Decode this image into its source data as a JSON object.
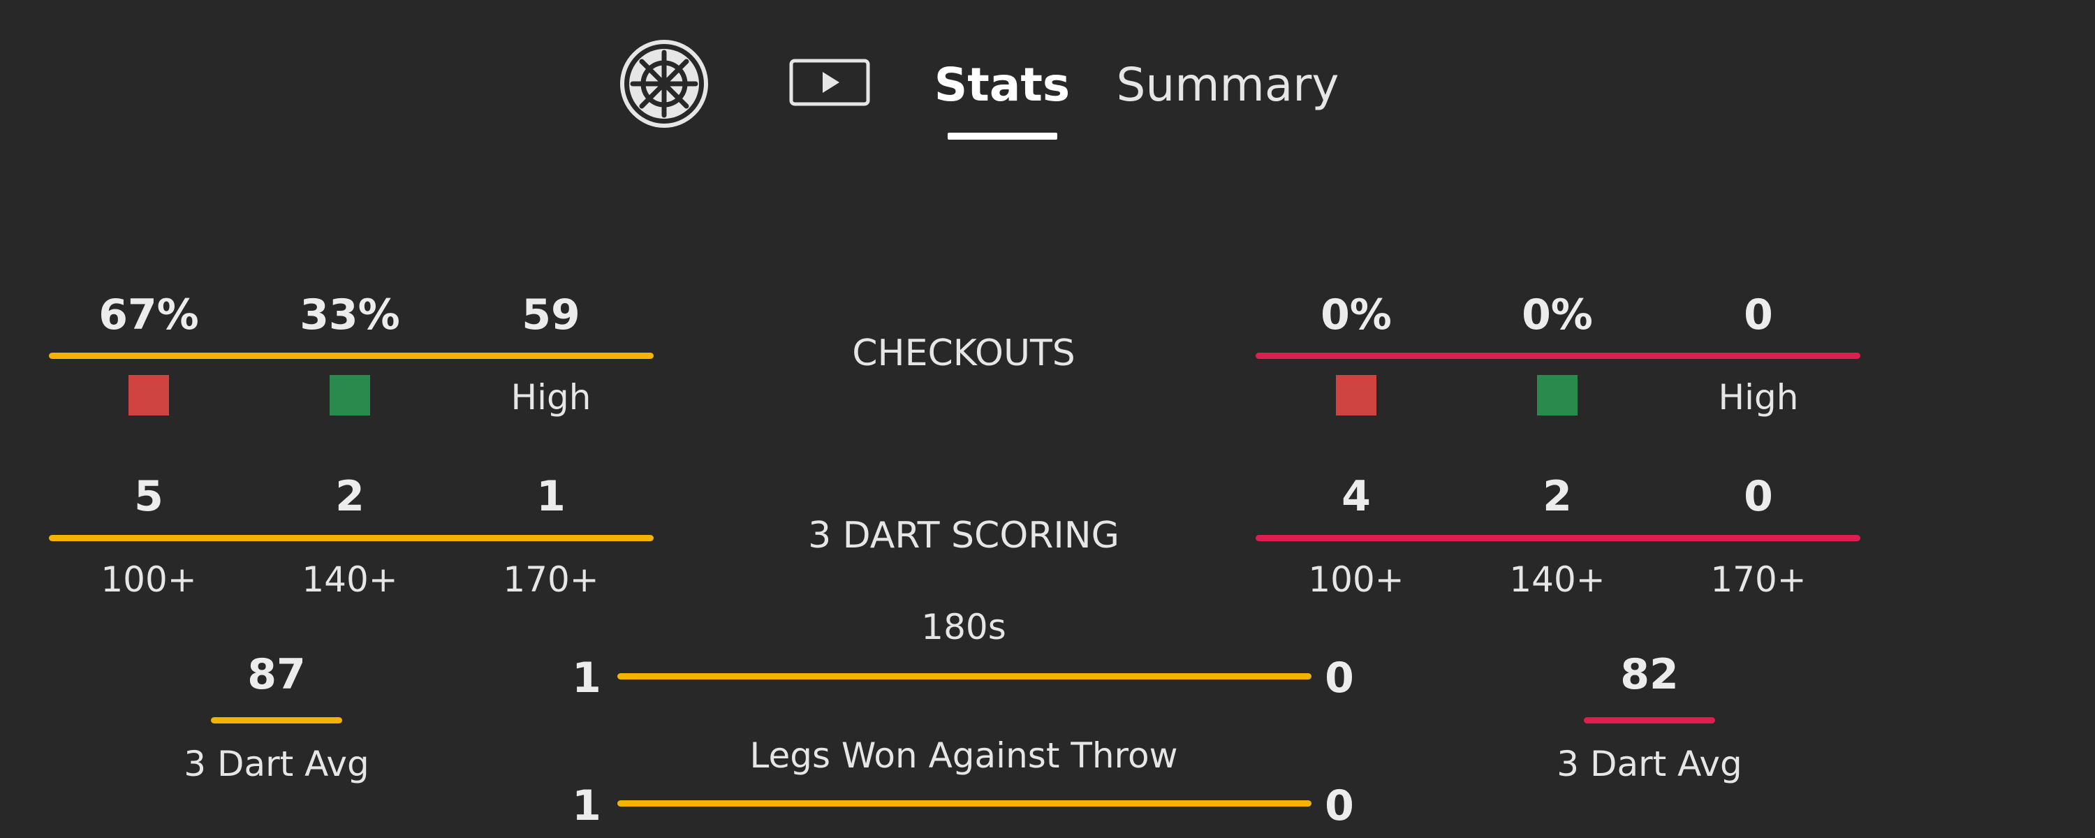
{
  "nav": {
    "tabs": [
      {
        "label": "Stats",
        "active": true
      },
      {
        "label": "Summary",
        "active": false
      }
    ],
    "icons": [
      "dartboard-icon",
      "video-play-icon"
    ]
  },
  "colors": {
    "background": "#282828",
    "player1": "#f4b301",
    "player2": "#dc1f4f",
    "miss": "#cf4440",
    "hit": "#2a8a4e"
  },
  "checkouts": {
    "title": "CHECKOUTS",
    "player1": {
      "values": [
        "67%",
        "33%",
        "59"
      ],
      "high_label": "High"
    },
    "player2": {
      "values": [
        "0%",
        "0%",
        "0"
      ],
      "high_label": "High"
    }
  },
  "scoring": {
    "title": "3 DART SCORING",
    "labels": [
      "100+",
      "140+",
      "170+"
    ],
    "player1": {
      "values": [
        "5",
        "2",
        "1"
      ]
    },
    "player2": {
      "values": [
        "4",
        "2",
        "0"
      ]
    }
  },
  "comparisons": [
    {
      "title": "180s",
      "player1": "1",
      "player2": "0",
      "player1_share": 1.0
    },
    {
      "title": "Legs Won Against Throw",
      "player1": "1",
      "player2": "0",
      "player1_share": 1.0
    }
  ],
  "average": {
    "label": "3 Dart Avg",
    "player1": "87",
    "player2": "82"
  }
}
